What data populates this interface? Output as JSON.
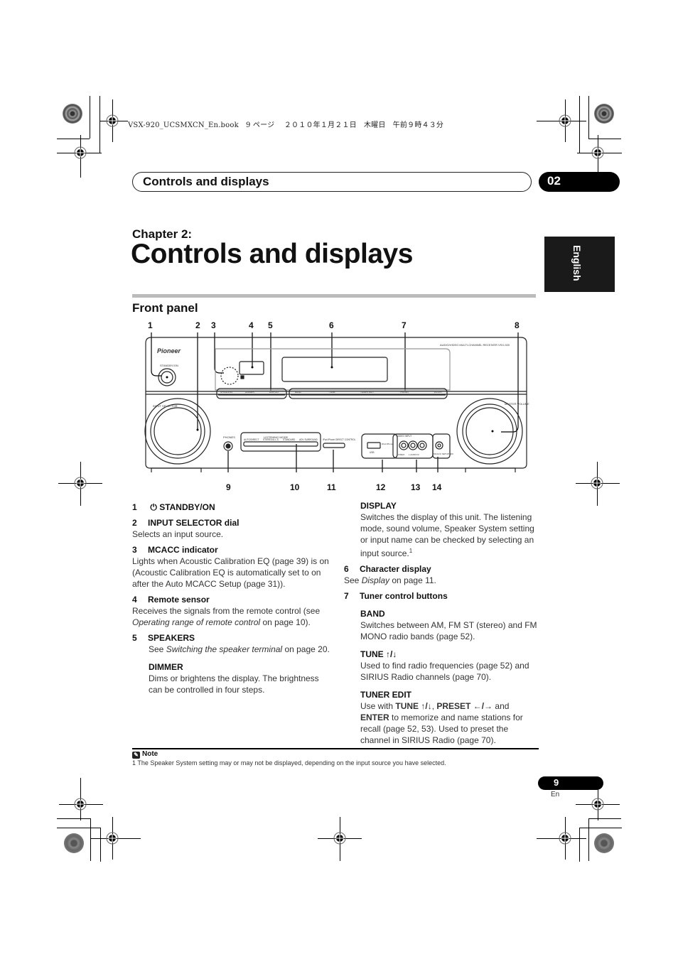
{
  "print_header": {
    "book_file": "VSX-920_UCSMXCN_En.book",
    "page_jp": "9 ページ",
    "date_jp": "２０１０年１月２１日",
    "weekday_jp": "木曜日",
    "time_jp": "午前９時４３分"
  },
  "running_header": {
    "title": "Controls and displays",
    "chapter_num": "02"
  },
  "chapter": {
    "label": "Chapter 2:",
    "title": "Controls and displays"
  },
  "language_tab": "English",
  "section": {
    "title": "Front panel"
  },
  "diagram": {
    "callouts_top": [
      "1",
      "2",
      "3",
      "4",
      "5",
      "6",
      "7",
      "8"
    ],
    "callouts_bottom": [
      "9",
      "10",
      "11",
      "12",
      "13",
      "14"
    ],
    "brand": "Pioneer",
    "model_line": "AUDIO/VIDEO MULTI-CHANNEL RECEIVER  VSX-920",
    "standby_label": "STANDBY/ON",
    "input_selector_label": "INPUT SELECTOR",
    "master_volume_label": "MASTER VOLUME",
    "phones_label": "PHONES",
    "listening_mode_label": "LISTENING MODE",
    "listening_mode_buttons": [
      "AUTO/DIRECT",
      "STEREO/A.L.S.",
      "STANDARD",
      "ADV SURROUND"
    ],
    "ipod_label": "iPod iPhone DIRECT CONTROL",
    "left_buttons": [
      "SPEAKERS",
      "DIMMER",
      "DISPLAY"
    ],
    "tuner_buttons": [
      "BAND",
      "TUNE",
      "TUNER EDIT",
      "PRESET",
      "ENTER"
    ],
    "video_input_label": "VIDEO INPUT",
    "usb_label": "USB",
    "ipod_port_label": "iPod iPhone",
    "jack_labels": [
      "VIDEO",
      "L  AUDIO  R"
    ],
    "mcacc_mic_label": "MCACC SETUP MIC"
  },
  "left_column": {
    "items": [
      {
        "num": "1",
        "icon": "power-icon",
        "title": "STANDBY/ON"
      },
      {
        "num": "2",
        "title": "INPUT SELECTOR dial",
        "body": "Selects an input source."
      },
      {
        "num": "3",
        "title": "MCACC indicator",
        "body": "Lights when Acoustic Calibration EQ (page 39) is on (Acoustic Calibration EQ is automatically set to on after the Auto MCACC Setup (page 31))."
      },
      {
        "num": "4",
        "title": "Remote sensor",
        "body_pre": "Receives the signals from the remote control (see ",
        "body_italic": "Operating range of remote control",
        "body_post": " on page 10)."
      },
      {
        "num": "5",
        "title": "SPEAKERS",
        "body_pre": "See ",
        "body_italic": "Switching the speaker terminal",
        "body_post": " on page 20."
      }
    ],
    "dimmer": {
      "title": "DIMMER",
      "body": "Dims or brightens the display. The brightness can be controlled in four steps."
    }
  },
  "right_column": {
    "display": {
      "title": "DISPLAY",
      "body": "Switches the display of this unit. The listening mode, sound volume, Speaker System setting or input name can be checked by selecting an input source.",
      "footnote_ref": "1"
    },
    "item6": {
      "num": "6",
      "title": "Character display",
      "body_pre": "See ",
      "body_italic": "Display",
      "body_post": " on page 11."
    },
    "item7": {
      "num": "7",
      "title": "Tuner control buttons"
    },
    "band": {
      "title": "BAND",
      "body": "Switches between AM, FM ST (stereo) and FM MONO radio bands (page 52)."
    },
    "tune": {
      "title": "TUNE ↑/↓",
      "body": "Used to find radio frequencies (page 52) and SIRIUS Radio channels (page 70)."
    },
    "tuner_edit": {
      "title": "TUNER EDIT",
      "pre": "Use with ",
      "b1": "TUNE ↑/↓",
      "sep": ", ",
      "b2": "PRESET ←/→",
      "mid": " and ",
      "b3": "ENTER",
      "post": " to memorize and name stations for recall (page 52, 53). Used to preset the channel in SIRIUS Radio (page 70)."
    }
  },
  "note": {
    "title": "Note",
    "footnote": "1 The Speaker System setting may or may not be displayed, depending on the input source you have selected."
  },
  "page": {
    "number": "9",
    "lang": "En"
  }
}
